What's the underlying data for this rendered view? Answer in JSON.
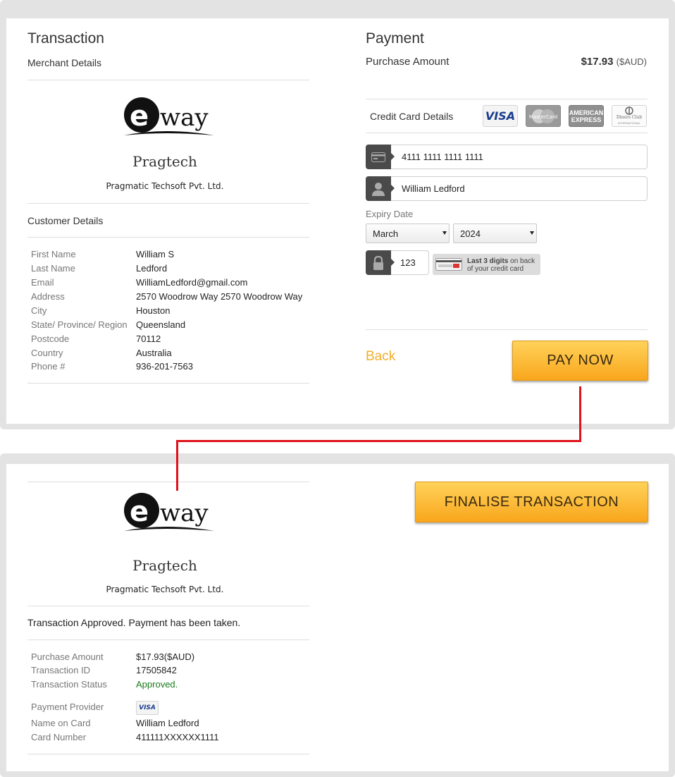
{
  "payment_form": {
    "transaction": {
      "title": "Transaction",
      "merchant_details_label": "Merchant Details",
      "brand_name": "Pragtech",
      "company_name": "Pragmatic Techsoft Pvt. Ltd.",
      "customer_details_label": "Customer Details",
      "customer": [
        {
          "label": "First Name",
          "value": "William S"
        },
        {
          "label": "Last Name",
          "value": "Ledford"
        },
        {
          "label": "Email",
          "value": "WilliamLedford@gmail.com"
        },
        {
          "label": "Address",
          "value": "2570 Woodrow Way 2570 Woodrow Way"
        },
        {
          "label": "City",
          "value": "Houston"
        },
        {
          "label": "State/ Province/ Region",
          "value": "Queensland"
        },
        {
          "label": "Postcode",
          "value": "70112"
        },
        {
          "label": "Country",
          "value": "Australia"
        },
        {
          "label": "Phone #",
          "value": "936-201-7563"
        }
      ]
    },
    "payment": {
      "title": "Payment",
      "purchase_amount_label": "Purchase Amount",
      "amount": "$17.93",
      "currency": "($AUD)",
      "credit_card_details_label": "Credit Card Details",
      "card_logos": [
        "visa-logo",
        "mastercard-logo",
        "american-express-logo",
        "diners-club-logo"
      ],
      "card_logo_text": {
        "visa": "VISA",
        "mastercard": "MasterCard",
        "amex_line1": "AMERICAN",
        "amex_line2": "EXPRESS",
        "diners": "Diners Club",
        "diners_sub": "INTERNATIONAL"
      },
      "card_number": "4111 1111 1111 1111",
      "card_name": "William Ledford",
      "expiry_label": "Expiry Date",
      "expiry_month": "March",
      "expiry_year": "2024",
      "cvn": "123",
      "cvn_hint_bold": "Last 3 digits",
      "cvn_hint_rest": " on back",
      "cvn_hint_line2": "of your credit card",
      "back_label": "Back",
      "pay_now_label": "PAY NOW"
    }
  },
  "result": {
    "brand_name": "Pragtech",
    "company_name": "Pragmatic Techsoft Pvt. Ltd.",
    "message": "Transaction Approved. Payment has been taken.",
    "finalise_label": "FINALISE TRANSACTION",
    "details": [
      {
        "label": "Purchase Amount",
        "value": "$17.93($AUD)"
      },
      {
        "label": "Transaction ID",
        "value": "17505842"
      },
      {
        "label": "Transaction Status",
        "value": "Approved."
      }
    ],
    "payment_provider_label": "Payment Provider",
    "payment_provider_logo": "VISA",
    "card_details": [
      {
        "label": "Name on Card",
        "value": "William Ledford"
      },
      {
        "label": "Card Number",
        "value": "411111XXXXXX1111"
      }
    ]
  },
  "logo_text": "way",
  "colors": {
    "accent_orange": "#f9a61c",
    "back_link": "#f3ad2a",
    "approved_green": "#1a7a1a",
    "connector_red": "#e0121b"
  }
}
